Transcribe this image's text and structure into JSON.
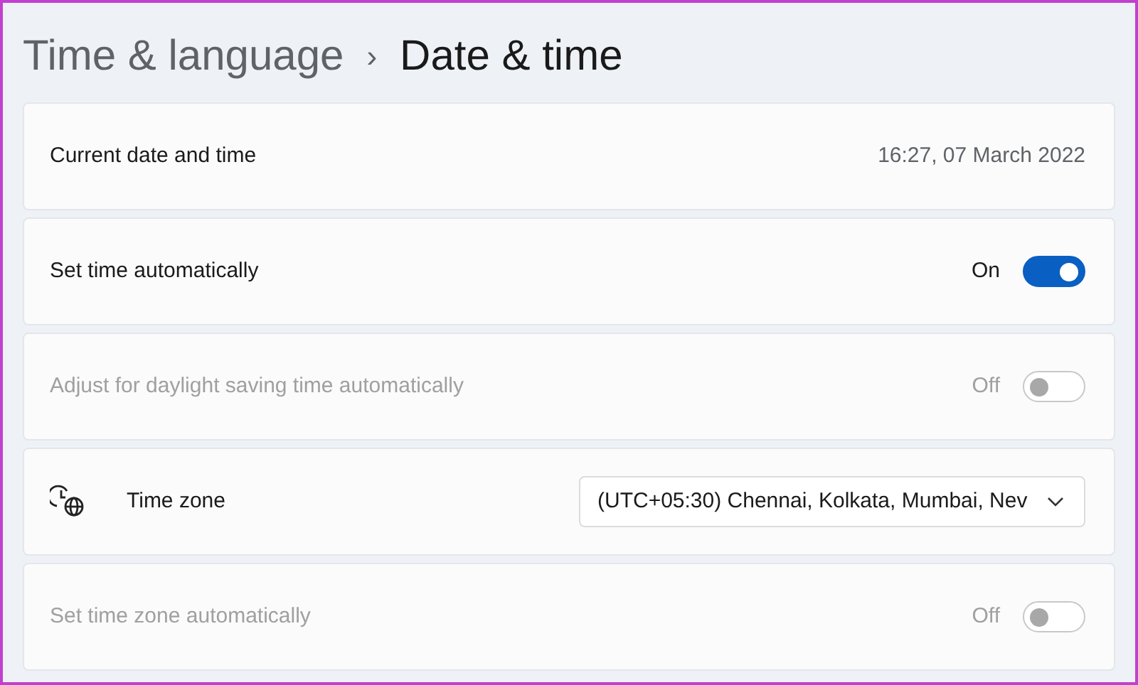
{
  "breadcrumb": {
    "parent": "Time & language",
    "separator": "›",
    "current": "Date & time"
  },
  "rows": [
    {
      "kind": "value",
      "label": "Current date and time",
      "value": "16:27, 07 March 2022"
    },
    {
      "kind": "toggle",
      "label": "Set time automatically",
      "state_text": "On",
      "on": true,
      "disabled": false
    },
    {
      "kind": "toggle",
      "label": "Adjust for daylight saving time automatically",
      "state_text": "Off",
      "on": false,
      "disabled": true
    },
    {
      "kind": "dropdown",
      "label": "Time zone",
      "value": "(UTC+05:30) Chennai, Kolkata, Mumbai, Nev"
    },
    {
      "kind": "toggle",
      "label": "Set time zone automatically",
      "state_text": "Off",
      "on": false,
      "disabled": true
    }
  ]
}
